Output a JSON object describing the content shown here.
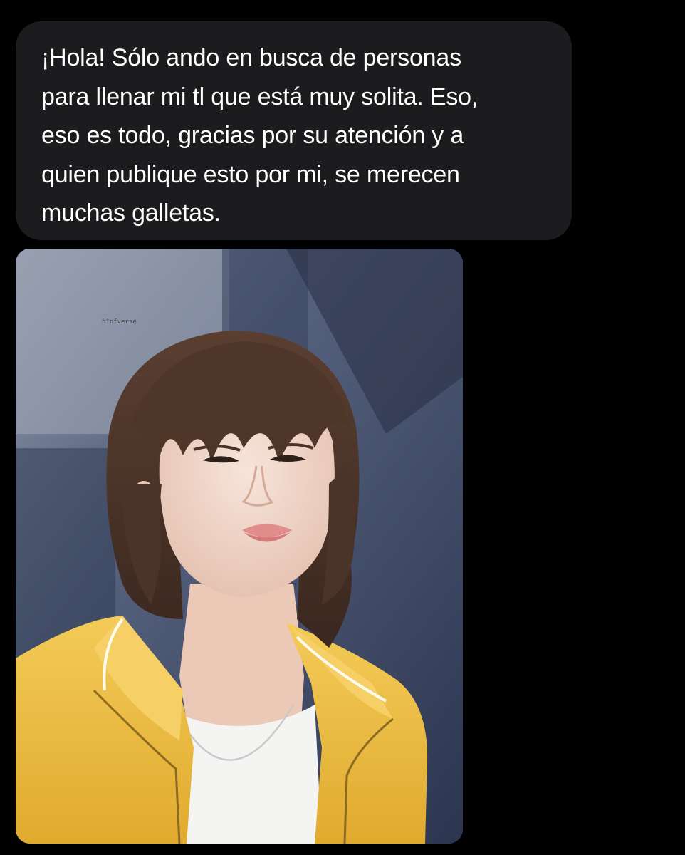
{
  "message": {
    "text": "¡Hola! Sólo ando en busca de personas\npara llenar mi tl que está muy solita. Eso,\neso es todo, gracias por su atención y a\nquien publique esto por mi, se merecen\nmuchas galletas."
  },
  "attachment": {
    "watermark": "h°nfverse",
    "colors": {
      "jacket": "#f0c24a",
      "hair": "#4a3328",
      "skin": "#f1d8cc",
      "background": "#3f4b68"
    }
  }
}
